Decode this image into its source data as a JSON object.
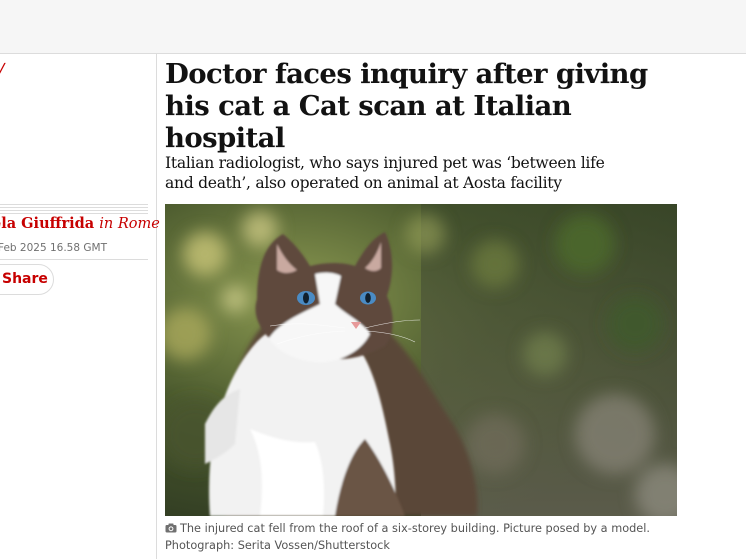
{
  "article": {
    "kicker_fragment": "/",
    "headline": "Doctor faces inquiry after giving his cat a Cat scan at Italian hospital",
    "standfirst": "Italian radiologist, who says injured pet was ‘between life and death’, also operated on animal at Aosta facility",
    "byline_name": "ela Giuffrida",
    "byline_location": "in Rome",
    "dateline": "Feb 2025 16.58 GMT",
    "share_label": "Share",
    "image": {
      "caption": "The injured cat fell from the roof of a six-storey building. Picture posed by a model.",
      "credit": "Photograph: Serita Vossen/Shutterstock"
    }
  },
  "icons": {
    "caption": "camera-icon"
  },
  "colors": {
    "accent": "#c70000",
    "text": "#121212",
    "caption": "#545454",
    "rule": "#dcdcdc",
    "topbar": "#f6f6f6"
  }
}
